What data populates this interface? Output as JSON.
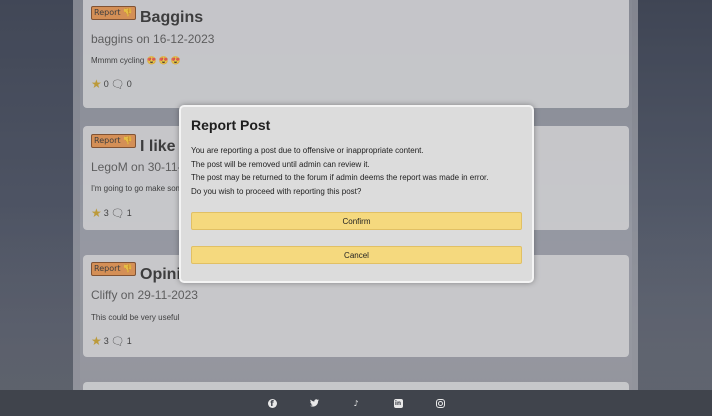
{
  "posts": [
    {
      "report_label": "Report",
      "title": "Baggins",
      "byline": "baggins on 16-12-2023",
      "body": "Mmmm cycling 😍 😍 😍",
      "stars": "0",
      "comments": "0"
    },
    {
      "report_label": "Report",
      "title": "I like ch",
      "byline": "LegoM on 30-11-202",
      "body": "I'm going to go make some",
      "stars": "3",
      "comments": "1"
    },
    {
      "report_label": "Report",
      "title": "Opinion",
      "byline": "Cliffy on 29-11-2023",
      "body": "This could be very useful",
      "stars": "3",
      "comments": "1"
    }
  ],
  "modal": {
    "title": "Report Post",
    "lines": [
      "You are reporting a post due to offensive or inappropriate content.",
      "The post will be removed until admin can review it.",
      "The post may be returned to the forum if admin deems the report was made in error.",
      "Do you wish to proceed with reporting this post?"
    ],
    "confirm_label": "Confirm",
    "cancel_label": "Cancel"
  },
  "footer": {
    "icons": [
      "facebook-icon",
      "twitter-icon",
      "tiktok-icon",
      "linkedin-icon",
      "instagram-icon"
    ]
  },
  "colors": {
    "report_button": "#e88d3f",
    "modal_button": "#f5d97e",
    "footer_bg": "#40444c"
  }
}
